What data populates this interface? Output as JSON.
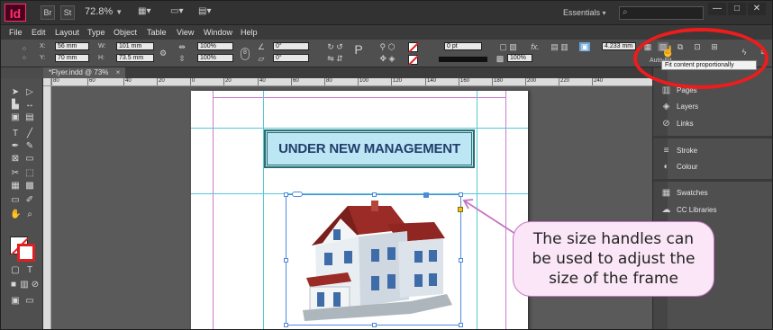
{
  "app": {
    "logo": "Id",
    "bridge_btn": "Br",
    "stock_btn": "St",
    "zoom": "72.8%",
    "workspace": "Essentials",
    "search_placeholder": ""
  },
  "window_controls": {
    "minimize": "—",
    "maximize": "□",
    "close": "✕"
  },
  "menu": [
    "File",
    "Edit",
    "Layout",
    "Type",
    "Object",
    "Table",
    "View",
    "Window",
    "Help"
  ],
  "control_panel": {
    "x_label": "X:",
    "x_value": "56 mm",
    "y_label": "Y:",
    "y_value": "70 mm",
    "w_label": "W:",
    "w_value": "101 mm",
    "h_label": "H:",
    "h_value": "73.5 mm",
    "scale_x": "100%",
    "scale_y": "100%",
    "rotate": "0°",
    "shear": "0°",
    "stroke_weight": "0 pt",
    "offset": "4.233 mm",
    "opacity": "100%",
    "auto_fit_label": "Auto-Fit",
    "tooltip": "Fit content proportionally"
  },
  "document": {
    "tab_title": "*Flyer.indd @ 73%",
    "tab_close": "×"
  },
  "ruler": {
    "labels": [
      "80",
      "60",
      "40",
      "20",
      "0",
      "20",
      "40",
      "60",
      "80",
      "100",
      "120",
      "140",
      "160",
      "180",
      "200",
      "220",
      "240"
    ]
  },
  "page": {
    "headline": "UNDER NEW MANAGEMENT"
  },
  "panels": [
    {
      "label": "Pages",
      "icon": "pages-icon"
    },
    {
      "label": "Layers",
      "icon": "layers-icon"
    },
    {
      "label": "Links",
      "icon": "links-icon"
    },
    {
      "label": "Stroke",
      "icon": "stroke-icon"
    },
    {
      "label": "Colour",
      "icon": "colour-icon"
    },
    {
      "label": "Swatches",
      "icon": "swatches-icon"
    },
    {
      "label": "CC Libraries",
      "icon": "cc-libraries-icon"
    }
  ],
  "callout": {
    "line1": "The size handles can",
    "line2": "be used to adjust the",
    "line3": "size of the frame"
  },
  "colors": {
    "accent_red": "#ee1c1c",
    "callout_border": "#c675c0",
    "headline_fill": "#bde6f5",
    "headline_text": "#223e6c"
  }
}
